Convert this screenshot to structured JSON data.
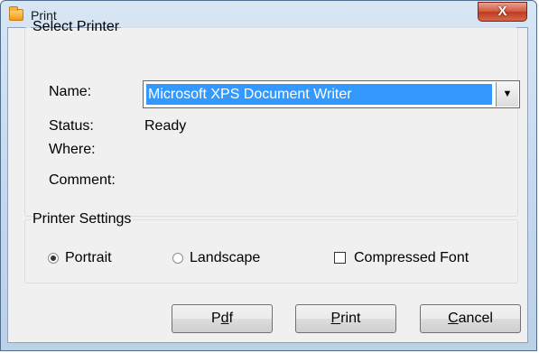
{
  "window": {
    "title": "Print",
    "close_glyph": "X"
  },
  "select_printer": {
    "legend": "Select Printer",
    "name_label": "Name:",
    "name_value": "Microsoft XPS Document Writer",
    "dropdown_arrow": "▼",
    "status_label": "Status:",
    "status_value": "Ready",
    "where_label": "Where:",
    "where_value": "",
    "comment_label": "Comment:",
    "comment_value": ""
  },
  "printer_settings": {
    "legend": "Printer Settings",
    "portrait_label": "Portrait",
    "portrait_checked": true,
    "landscape_label": "Landscape",
    "landscape_checked": false,
    "compressed_label": "Compressed Font",
    "compressed_checked": false
  },
  "buttons": {
    "pdf": {
      "pre": "P",
      "mnemonic": "d",
      "post": "f"
    },
    "print": {
      "pre": "",
      "mnemonic": "P",
      "post": "rint"
    },
    "cancel": {
      "pre": "",
      "mnemonic": "C",
      "post": "ancel"
    }
  }
}
